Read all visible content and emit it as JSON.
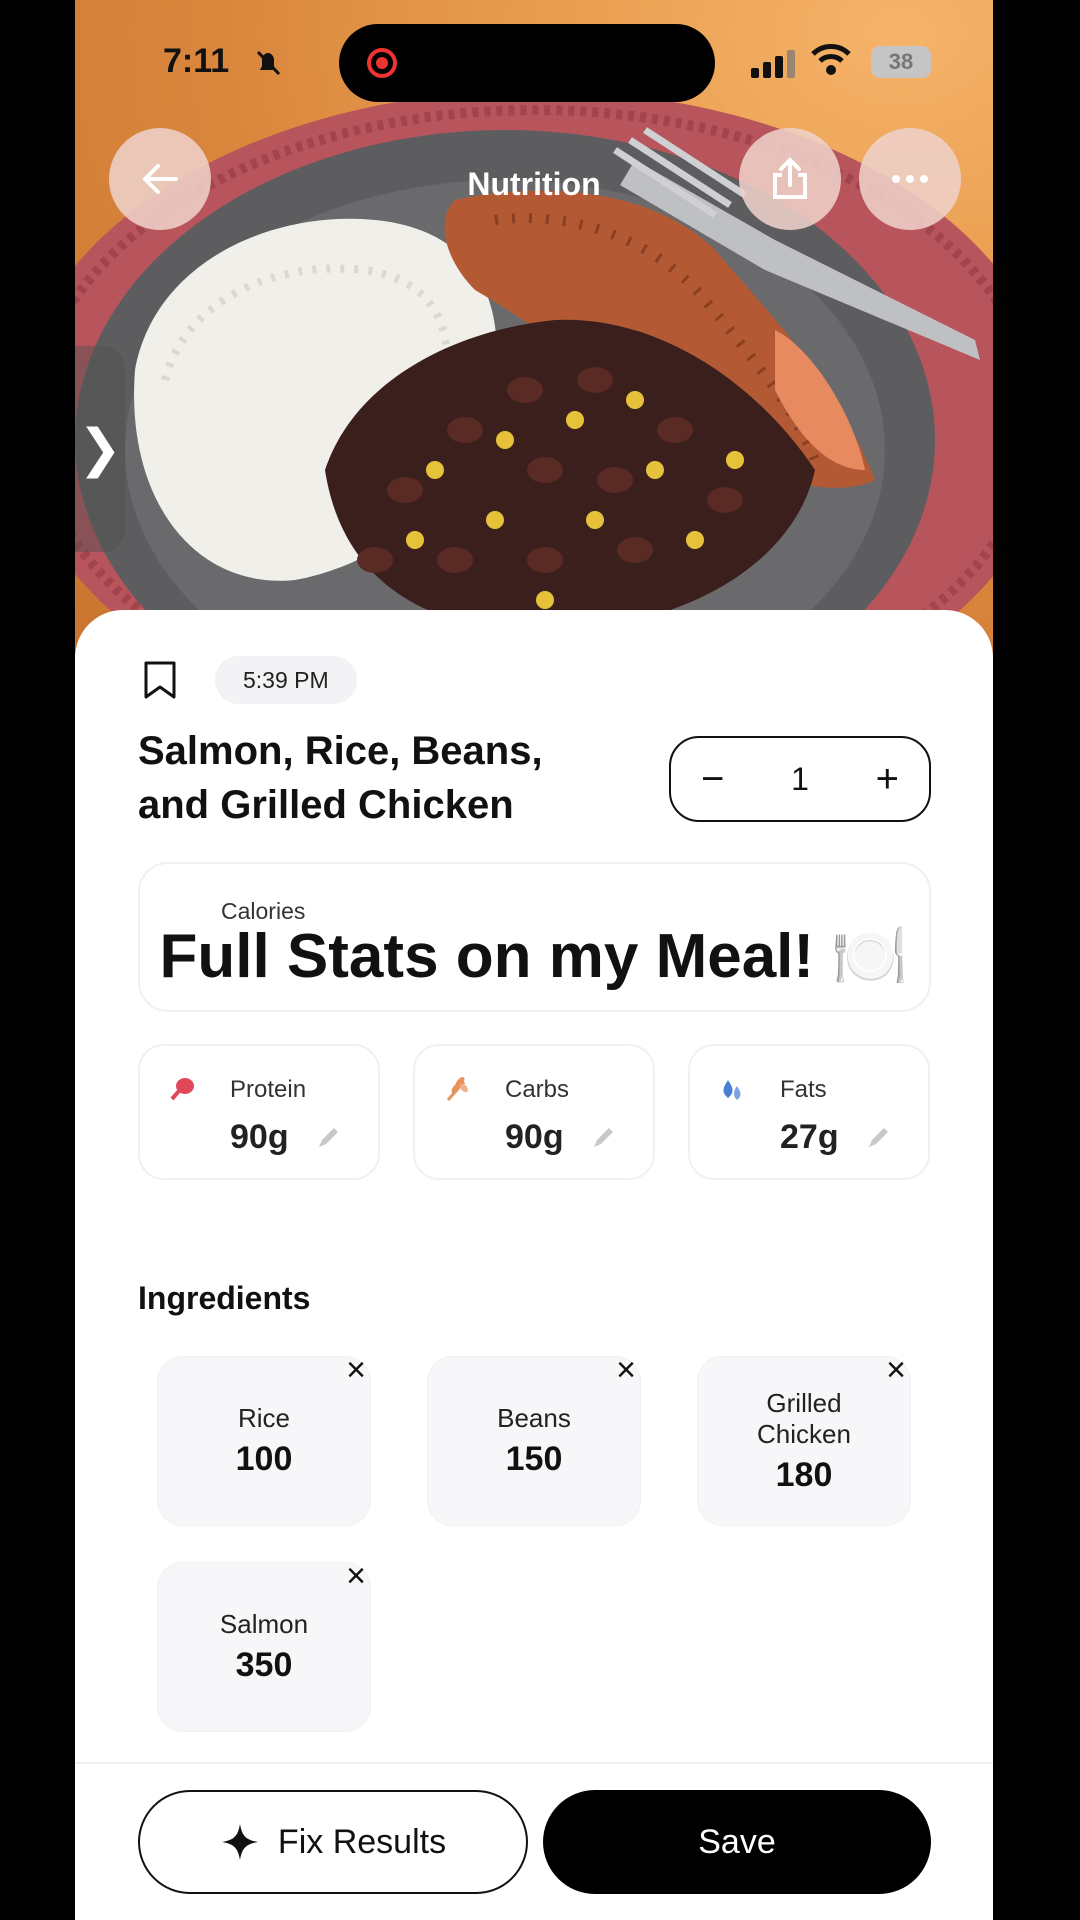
{
  "status_bar": {
    "time": "7:11",
    "battery": "38"
  },
  "header": {
    "title": "Nutrition"
  },
  "meal": {
    "time": "5:39 PM",
    "title": "Salmon, Rice, Beans, and Grilled Chicken",
    "servings": "1",
    "calories_label": "Calories"
  },
  "caption": "Full Stats on my Meal! 🍽️",
  "macros": [
    {
      "label": "Protein",
      "value": "90g",
      "icon": "drumstick-icon",
      "color": "#e0485a"
    },
    {
      "label": "Carbs",
      "value": "90g",
      "icon": "wheat-icon",
      "color": "#e8935a"
    },
    {
      "label": "Fats",
      "value": "27g",
      "icon": "droplets-icon",
      "color": "#4a7fd6"
    }
  ],
  "ingredients_heading": "Ingredients",
  "ingredients": [
    {
      "name": "Rice",
      "value": "100"
    },
    {
      "name": "Beans",
      "value": "150"
    },
    {
      "name": "Grilled Chicken",
      "value": "180"
    },
    {
      "name": "Salmon",
      "value": "350"
    }
  ],
  "actions": {
    "fix": "Fix Results",
    "save": "Save"
  }
}
